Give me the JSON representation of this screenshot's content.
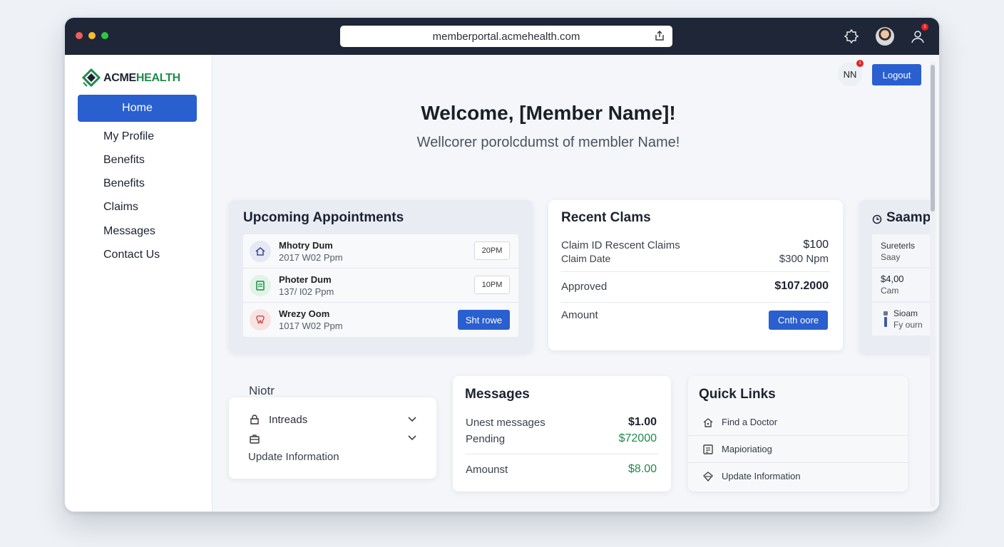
{
  "browser": {
    "url": "memberportal.acmehealth.com",
    "notification_count": "1"
  },
  "sidebar": {
    "logo": {
      "brand": "ACME",
      "suffix": "HEALTH"
    },
    "items": [
      {
        "label": "Home",
        "active": true
      },
      {
        "label": "My Profile"
      },
      {
        "label": "Benefits"
      },
      {
        "label": "Benefits"
      },
      {
        "label": "Claims"
      },
      {
        "label": "Messages"
      },
      {
        "label": "Contact Us"
      }
    ]
  },
  "header": {
    "user_initials": "NN",
    "user_badge": "1",
    "logout_label": "Logout"
  },
  "welcome": {
    "title": "Welcome, [Member Name]!",
    "subtitle": "Wellcorer porolcdumst of membler Name!"
  },
  "appointments": {
    "title": "Upcoming Appointments",
    "rows": [
      {
        "name": "Mhotry Dum",
        "date": "2017 W02 Ppm",
        "time": "20PM"
      },
      {
        "name": "Photer Dum",
        "date": "137/ I02 Ppm",
        "time": "10PM"
      },
      {
        "name": "Wrezy Oom",
        "date": "1017 W02 Ppm",
        "button": "Sht rowe"
      }
    ]
  },
  "claims": {
    "title": "Recent Clams",
    "rows": [
      {
        "label": "Claim ID Rescent Claims",
        "value": "$100"
      },
      {
        "label": "Claim Date",
        "value": "$300 Npm"
      },
      {
        "label": "Approved",
        "value": "$107.2000"
      },
      {
        "label": "Amount",
        "button": "Cnth oore"
      }
    ]
  },
  "sample": {
    "title": "Saamp",
    "rows": [
      {
        "line1": "Sureterls",
        "line2": "Saay"
      },
      {
        "line1": "$4,00",
        "line2": "Cam"
      },
      {
        "line1": "Sioam",
        "line2": "Fy ourn"
      }
    ]
  },
  "notifications": {
    "title": "Niotr",
    "items": [
      {
        "label": "Intreads"
      },
      {
        "label": ""
      }
    ],
    "footer": "Update Information"
  },
  "messages": {
    "title": "Messages",
    "rows": [
      {
        "label": "Unest messages",
        "value": "$1.00"
      },
      {
        "label": "Pending",
        "value": "$72000"
      },
      {
        "label": "Amounst",
        "value": "$8.00"
      }
    ]
  },
  "quick_links": {
    "title": "Quick Links",
    "items": [
      {
        "label": "Find a Doctor",
        "icon": "house-icon"
      },
      {
        "label": "Mapioriatiog",
        "icon": "list-icon"
      },
      {
        "label": "Update Information",
        "icon": "shield-icon"
      }
    ]
  },
  "colors": {
    "primary": "#2a5fcf",
    "brand_green": "#1f8a4c",
    "titlebar": "#1e2638",
    "alert_red": "#e02424"
  }
}
